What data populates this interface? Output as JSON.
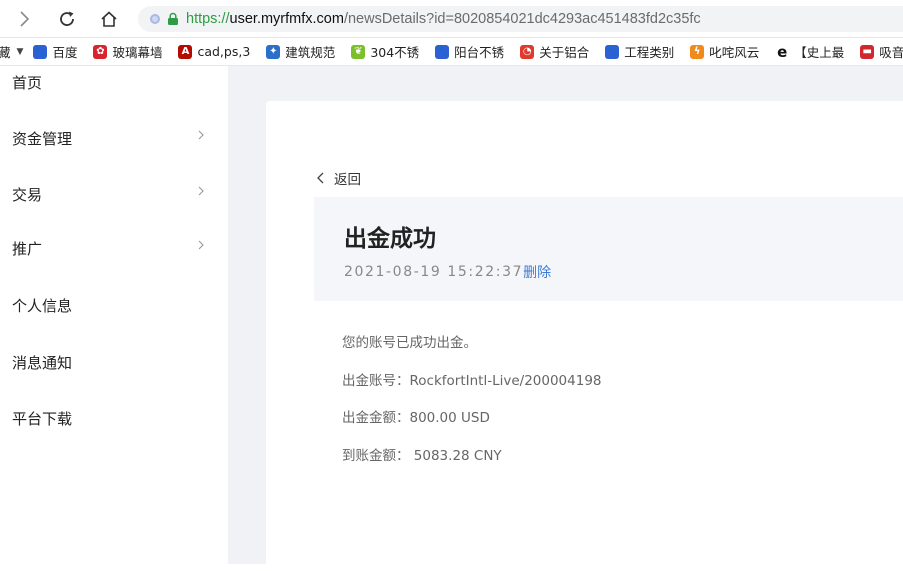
{
  "browser": {
    "url_scheme": "https://",
    "url_host": "user.myrfmfx.com",
    "url_path": "/newsDetails?id=8020854021dc4293ac451483fd2c35fc"
  },
  "bookmarks": {
    "first": "藏",
    "items": [
      {
        "label": "百度",
        "icon": "paw-icon",
        "color": "#2f5fd6"
      },
      {
        "label": "玻璃幕墙",
        "icon": "flower-icon",
        "color": "#d9232d"
      },
      {
        "label": "cad,ps,3",
        "icon": "letter-a-icon",
        "color": "#b30b00"
      },
      {
        "label": "建筑规范",
        "icon": "compass-icon",
        "color": "#2c6fc9"
      },
      {
        "label": "304不锈",
        "icon": "leaf-icon",
        "color": "#7bbf2b"
      },
      {
        "label": "阳台不锈",
        "icon": "paw-icon",
        "color": "#2f5fd6"
      },
      {
        "label": "关于铝合",
        "icon": "swirl-icon",
        "color": "#e03a2f"
      },
      {
        "label": "工程类别",
        "icon": "paw-icon",
        "color": "#2f5fd6"
      },
      {
        "label": "叱咤风云",
        "icon": "flame-icon",
        "color": "#f08a1c"
      },
      {
        "label": "【史上最",
        "icon": "letter-e-icon",
        "color": "#111111"
      },
      {
        "label": "吸音系列",
        "icon": "brand-icon",
        "color": "#d0282e"
      }
    ]
  },
  "sidebar": {
    "items": [
      {
        "label": "首页",
        "has_arrow": false
      },
      {
        "label": "资金管理",
        "has_arrow": true
      },
      {
        "label": "交易",
        "has_arrow": true
      },
      {
        "label": "推广",
        "has_arrow": true
      },
      {
        "label": "个人信息",
        "has_arrow": false
      },
      {
        "label": "消息通知",
        "has_arrow": false
      },
      {
        "label": "平台下载",
        "has_arrow": false
      }
    ]
  },
  "detail": {
    "back_label": "返回",
    "title": "出金成功",
    "time": "2021-08-19 15:22:37",
    "delete_label": "删除",
    "lines": [
      "您的账号已成功出金。",
      "出金账号：RockfortIntl-Live/200004198",
      "出金金额：800.00 USD",
      "到账金额： 5083.28 CNY"
    ]
  },
  "colors": {
    "link": "#3e7bd6",
    "main_bg": "#f0f2f5",
    "title_box_bg": "#f5f6f9"
  }
}
